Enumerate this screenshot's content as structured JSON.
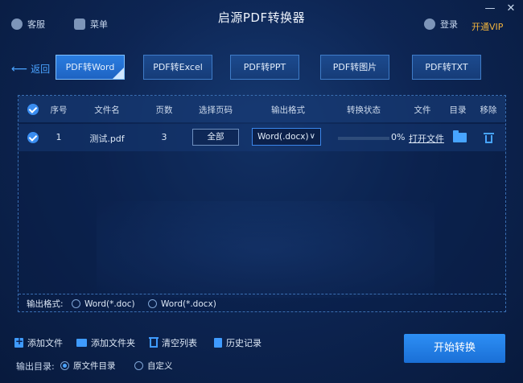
{
  "titlebar": {
    "service_label": "客服",
    "menu_label": "菜单",
    "app_title": "启源PDF转换器",
    "login_label": "登录",
    "vip_label": "开通VIP",
    "minimize": "—",
    "close": "✕"
  },
  "nav": {
    "back_label": "返回",
    "tabs": [
      "PDF转Word",
      "PDF转Excel",
      "PDF转PPT",
      "PDF转图片",
      "PDF转TXT"
    ],
    "active_tab": 0
  },
  "table": {
    "headers": [
      "序号",
      "文件名",
      "页数",
      "选择页码",
      "输出格式",
      "转换状态",
      "文件",
      "目录",
      "移除"
    ],
    "rows": [
      {
        "index": "1",
        "filename": "测试.pdf",
        "pages": "3",
        "page_select": "全部",
        "format": "Word(.docx)",
        "progress_fraction": 0,
        "progress_text": "0%",
        "open_file": "打开文件"
      }
    ]
  },
  "format_bar": {
    "label": "输出格式:",
    "options": [
      "Word(*.doc)",
      "Word(*.docx)"
    ],
    "selected": -1
  },
  "toolbar": {
    "add_file": "添加文件",
    "add_folder": "添加文件夹",
    "clear_list": "清空列表",
    "history": "历史记录"
  },
  "output_dir": {
    "label": "输出目录:",
    "options": [
      "原文件目录",
      "自定义"
    ],
    "selected": 0
  },
  "start_button": "开始转换",
  "colors": {
    "accent": "#3f9bff",
    "vip": "#f0b23c",
    "background": "#0d2553"
  }
}
